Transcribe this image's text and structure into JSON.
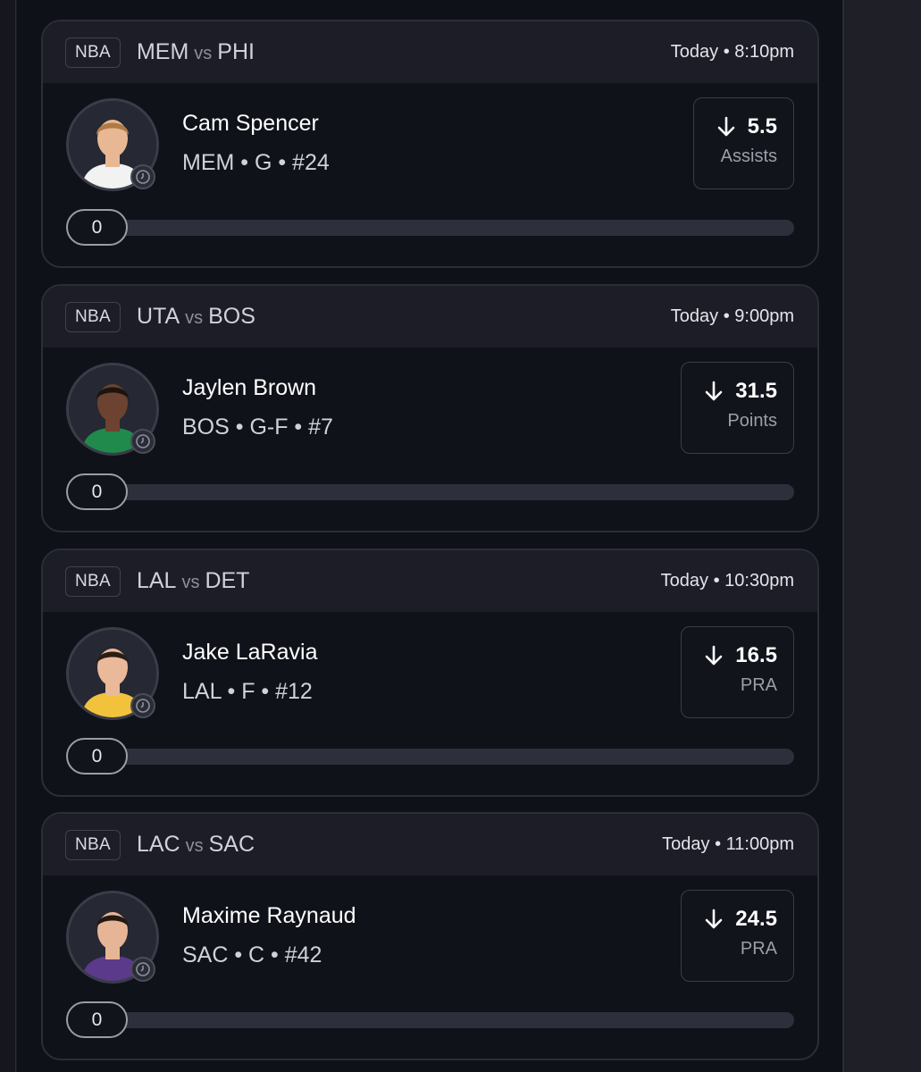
{
  "cards": [
    {
      "league": "NBA",
      "home": "MEM",
      "vs": "vs",
      "away": "PHI",
      "time": "Today • 8:10pm",
      "player": {
        "name": "Cam Spencer",
        "meta": "MEM • G • #24"
      },
      "line": {
        "direction": "down",
        "value": "5.5",
        "stat": "Assists"
      },
      "progress": {
        "value": "0",
        "fraction": 0
      },
      "avatar": {
        "skin": "#e8b894",
        "hair": "#b07a45",
        "jersey": "#f2f2f2"
      }
    },
    {
      "league": "NBA",
      "home": "UTA",
      "vs": "vs",
      "away": "BOS",
      "time": "Today • 9:00pm",
      "player": {
        "name": "Jaylen Brown",
        "meta": "BOS • G-F • #7"
      },
      "line": {
        "direction": "down",
        "value": "31.5",
        "stat": "Points"
      },
      "progress": {
        "value": "0",
        "fraction": 0
      },
      "avatar": {
        "skin": "#6b4330",
        "hair": "#1b1410",
        "jersey": "#1f8a4c"
      }
    },
    {
      "league": "NBA",
      "home": "LAL",
      "vs": "vs",
      "away": "DET",
      "time": "Today • 10:30pm",
      "player": {
        "name": "Jake LaRavia",
        "meta": "LAL • F • #12"
      },
      "line": {
        "direction": "down",
        "value": "16.5",
        "stat": "PRA"
      },
      "progress": {
        "value": "0",
        "fraction": 0
      },
      "avatar": {
        "skin": "#eab99a",
        "hair": "#2a1d16",
        "jersey": "#f3c23c"
      }
    },
    {
      "league": "NBA",
      "home": "LAC",
      "vs": "vs",
      "away": "SAC",
      "time": "Today • 11:00pm",
      "player": {
        "name": "Maxime Raynaud",
        "meta": "SAC • C • #42"
      },
      "line": {
        "direction": "down",
        "value": "24.5",
        "stat": "PRA"
      },
      "progress": {
        "value": "0",
        "fraction": 0
      },
      "avatar": {
        "skin": "#e6b596",
        "hair": "#231812",
        "jersey": "#5b3a8c"
      }
    }
  ]
}
